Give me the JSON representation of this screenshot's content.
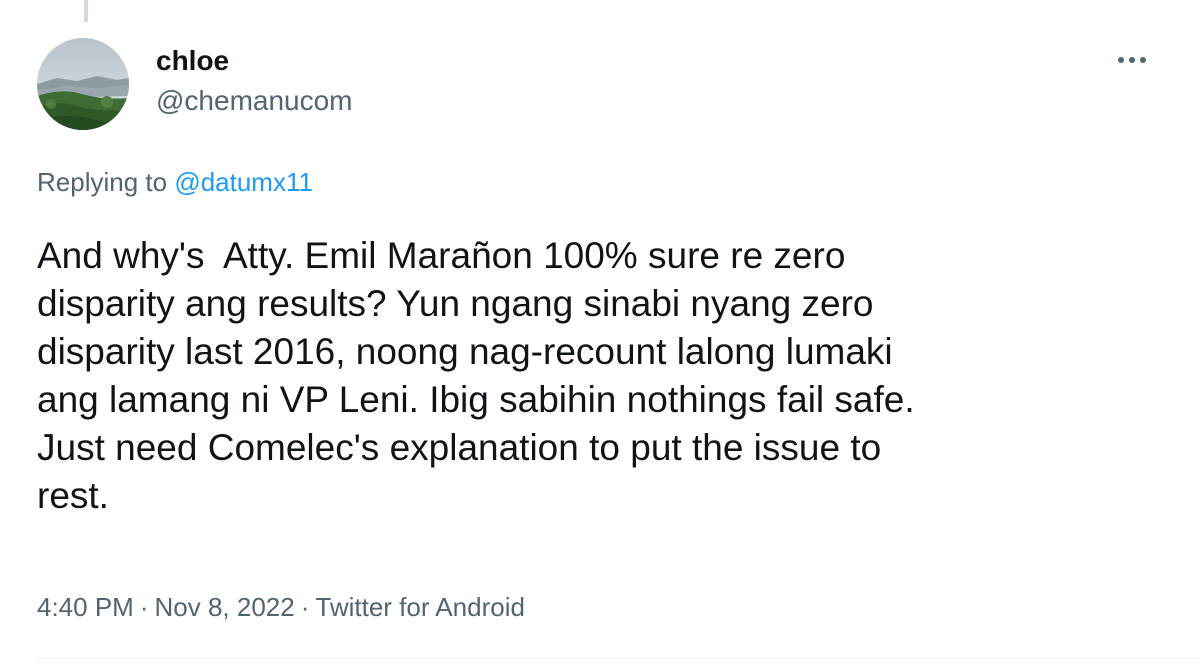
{
  "author": {
    "display_name": "chloe",
    "handle": "@chemanucom"
  },
  "reply": {
    "prefix": "Replying to ",
    "mention": "@datumx11"
  },
  "body": {
    "text": "And why's  Atty. Emil Marañon 100% sure re zero\ndisparity ang results? Yun ngang sinabi nyang zero\ndisparity last 2016, noong nag-recount lalong lumaki\nang lamang ni VP Leni. Ibig sabihin nothings fail safe.\nJust need Comelec's explanation to put the issue to\nrest."
  },
  "meta": {
    "time": "4:40 PM",
    "separator": "·",
    "date": "Nov 8, 2022",
    "source": "Twitter for Android"
  },
  "icons": {
    "more": "more-horizontal-icon",
    "avatar": "landscape-photo"
  },
  "colors": {
    "primary_text": "#0f1419",
    "secondary_text": "#536471",
    "accent": "#1d9bf0"
  }
}
